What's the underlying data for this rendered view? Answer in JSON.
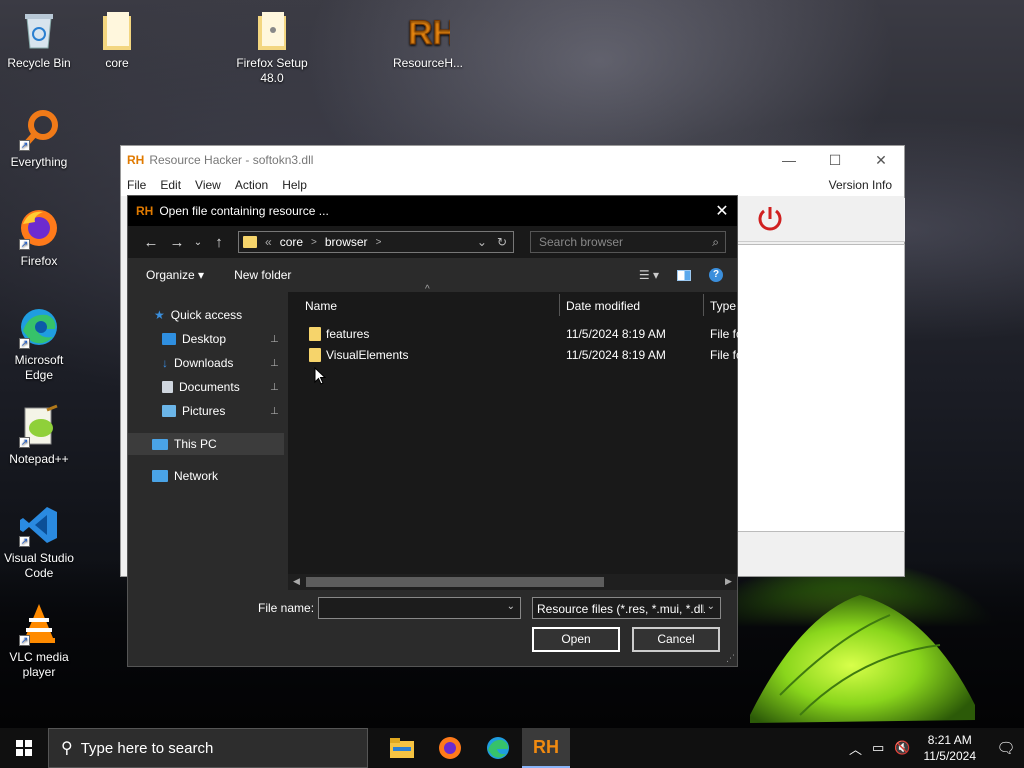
{
  "desktop": {
    "icons": [
      {
        "label": "Recycle Bin"
      },
      {
        "label": "core"
      },
      {
        "label": "Firefox Setup 48.0"
      },
      {
        "label": "ResourceH..."
      },
      {
        "label": "Everything"
      },
      {
        "label": "Firefox"
      },
      {
        "label": "Microsoft Edge"
      },
      {
        "label": "Notepad++"
      },
      {
        "label": "Visual Studio Code"
      },
      {
        "label": "VLC media player"
      }
    ]
  },
  "rh_window": {
    "logo": "RH",
    "title": "Resource Hacker - softokn3.dll",
    "menu": [
      "File",
      "Edit",
      "View",
      "Action",
      "Help"
    ],
    "version_info": "Version Info",
    "controls": {
      "minimize": "—",
      "maximize": "☐",
      "close": "✕"
    }
  },
  "dialog": {
    "logo": "RH",
    "title": "Open file containing resource ...",
    "close": "✕",
    "nav": {
      "back": "←",
      "forward": "→",
      "recent": "⌄",
      "up": "↑"
    },
    "address": {
      "prefix": "«",
      "crumbs": [
        "core",
        "browser"
      ],
      "sep": ">"
    },
    "search_placeholder": "Search browser",
    "commands": {
      "organize": "Organize ▾",
      "new_folder": "New folder"
    },
    "sidebar": {
      "quick_access": "Quick access",
      "items": [
        {
          "label": "Desktop",
          "color": "#2f8fe0"
        },
        {
          "label": "Downloads",
          "color": "#3a8ee6"
        },
        {
          "label": "Documents",
          "color": "#cfd6de"
        },
        {
          "label": "Pictures",
          "color": "#6bb5e8"
        }
      ],
      "pin": "📌",
      "this_pc": "This PC",
      "network": "Network"
    },
    "columns": {
      "name": "Name",
      "date": "Date modified",
      "type": "Type"
    },
    "files": [
      {
        "name": "features",
        "date": "11/5/2024 8:19 AM",
        "type": "File fo"
      },
      {
        "name": "VisualElements",
        "date": "11/5/2024 8:19 AM",
        "type": "File fo"
      }
    ],
    "file_name_label": "File name:",
    "file_name_value": "",
    "file_type": "Resource files (*.res, *.mui, *.dll",
    "open_label": "Open",
    "cancel_label": "Cancel"
  },
  "taskbar": {
    "search_placeholder": "Type here to search",
    "time": "8:21 AM",
    "date": "11/5/2024"
  },
  "colors": {
    "folder": "#f6d46b",
    "rh_accent": "#e07a00",
    "help": "#3b8fdc"
  }
}
